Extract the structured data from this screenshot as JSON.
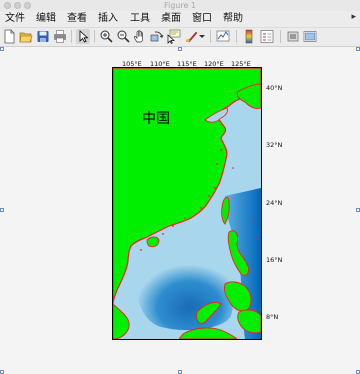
{
  "window": {
    "title": "Figure 1"
  },
  "menu": {
    "items": [
      "文件",
      "编辑",
      "查看",
      "插入",
      "工具",
      "桌面",
      "窗口",
      "帮助"
    ],
    "overflow_arrow": "▸"
  },
  "toolbar": {
    "icons": [
      "new-figure-icon",
      "open-folder-icon",
      "save-icon",
      "print-icon",
      "pointer-arrow-icon",
      "zoom-in-icon",
      "zoom-out-icon",
      "pan-hand-icon",
      "rotate-3d-icon",
      "data-cursor-icon",
      "brush-icon",
      "link-plot-icon",
      "colorbar-icon",
      "legend-icon",
      "hide-plot-tools-icon",
      "show-plot-tools-icon"
    ],
    "active": "pointer-arrow-icon"
  },
  "map": {
    "lon_ticks": [
      "105°E",
      "110°E",
      "115°E",
      "120°E",
      "125°E"
    ],
    "lat_ticks": [
      "40°N",
      "32°N",
      "24°N",
      "16°N",
      "8°N"
    ],
    "label": "中国",
    "colors": {
      "land": "#00ee00",
      "coast": "#ff1a1a",
      "shallow_sea": "#a8d6ec",
      "deep_sea": "#0078c8"
    }
  }
}
